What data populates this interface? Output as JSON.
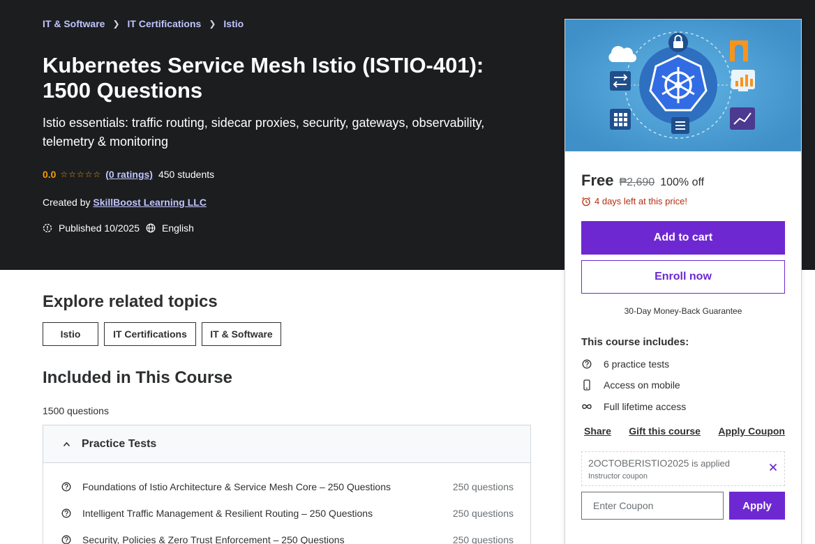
{
  "breadcrumb": [
    {
      "label": "IT & Software"
    },
    {
      "label": "IT Certifications"
    },
    {
      "label": "Istio"
    }
  ],
  "hero": {
    "title": "Kubernetes Service Mesh Istio (ISTIO-401): 1500 Questions",
    "subtitle": "Istio essentials: traffic routing, sidecar proxies, security, gateways, observability, telemetry & monitoring",
    "rating_value": "0.0",
    "stars": "☆☆☆☆☆",
    "ratings_link": "(0 ratings)",
    "students": "450 students",
    "created_by_prefix": "Created by",
    "instructor": "SkillBoost Learning LLC",
    "published": "Published 10/2025",
    "language": "English"
  },
  "topics": {
    "heading": "Explore related topics",
    "items": [
      {
        "label": "Istio"
      },
      {
        "label": "IT Certifications"
      },
      {
        "label": "IT & Software"
      }
    ]
  },
  "included": {
    "heading": "Included in This Course",
    "count": "1500 questions",
    "section_title": "Practice Tests",
    "items": [
      {
        "title": "Foundations of Istio Architecture & Service Mesh Core – 250 Questions",
        "count": "250 questions"
      },
      {
        "title": "Intelligent Traffic Management & Resilient Routing – 250 Questions",
        "count": "250 questions"
      },
      {
        "title": "Security, Policies & Zero Trust Enforcement – 250 Questions",
        "count": "250 questions"
      }
    ]
  },
  "purchase": {
    "price": "Free",
    "original_price": "₱2,690",
    "discount": "100% off",
    "timer": "4 days left at this price!",
    "add_to_cart": "Add to cart",
    "enroll": "Enroll now",
    "guarantee": "30-Day Money-Back Guarantee",
    "includes_heading": "This course includes:",
    "includes": [
      {
        "label": "6 practice tests",
        "icon": "question-circle-icon"
      },
      {
        "label": "Access on mobile",
        "icon": "mobile-icon"
      },
      {
        "label": "Full lifetime access",
        "icon": "infinity-icon"
      }
    ],
    "share": "Share",
    "gift": "Gift this course",
    "apply_coupon": "Apply Coupon",
    "coupon_code": "2OCTOBERISTIO2025",
    "coupon_applied": "is applied",
    "coupon_type": "Instructor coupon",
    "coupon_placeholder": "Enter Coupon",
    "apply_button": "Apply"
  },
  "colors": {
    "brand_purple": "#6d28d2",
    "hero_bg": "#1c1d1f",
    "rating_orange": "#f69c08",
    "link_lavender": "#c0c4fc",
    "timer_red": "#b32d0f"
  }
}
